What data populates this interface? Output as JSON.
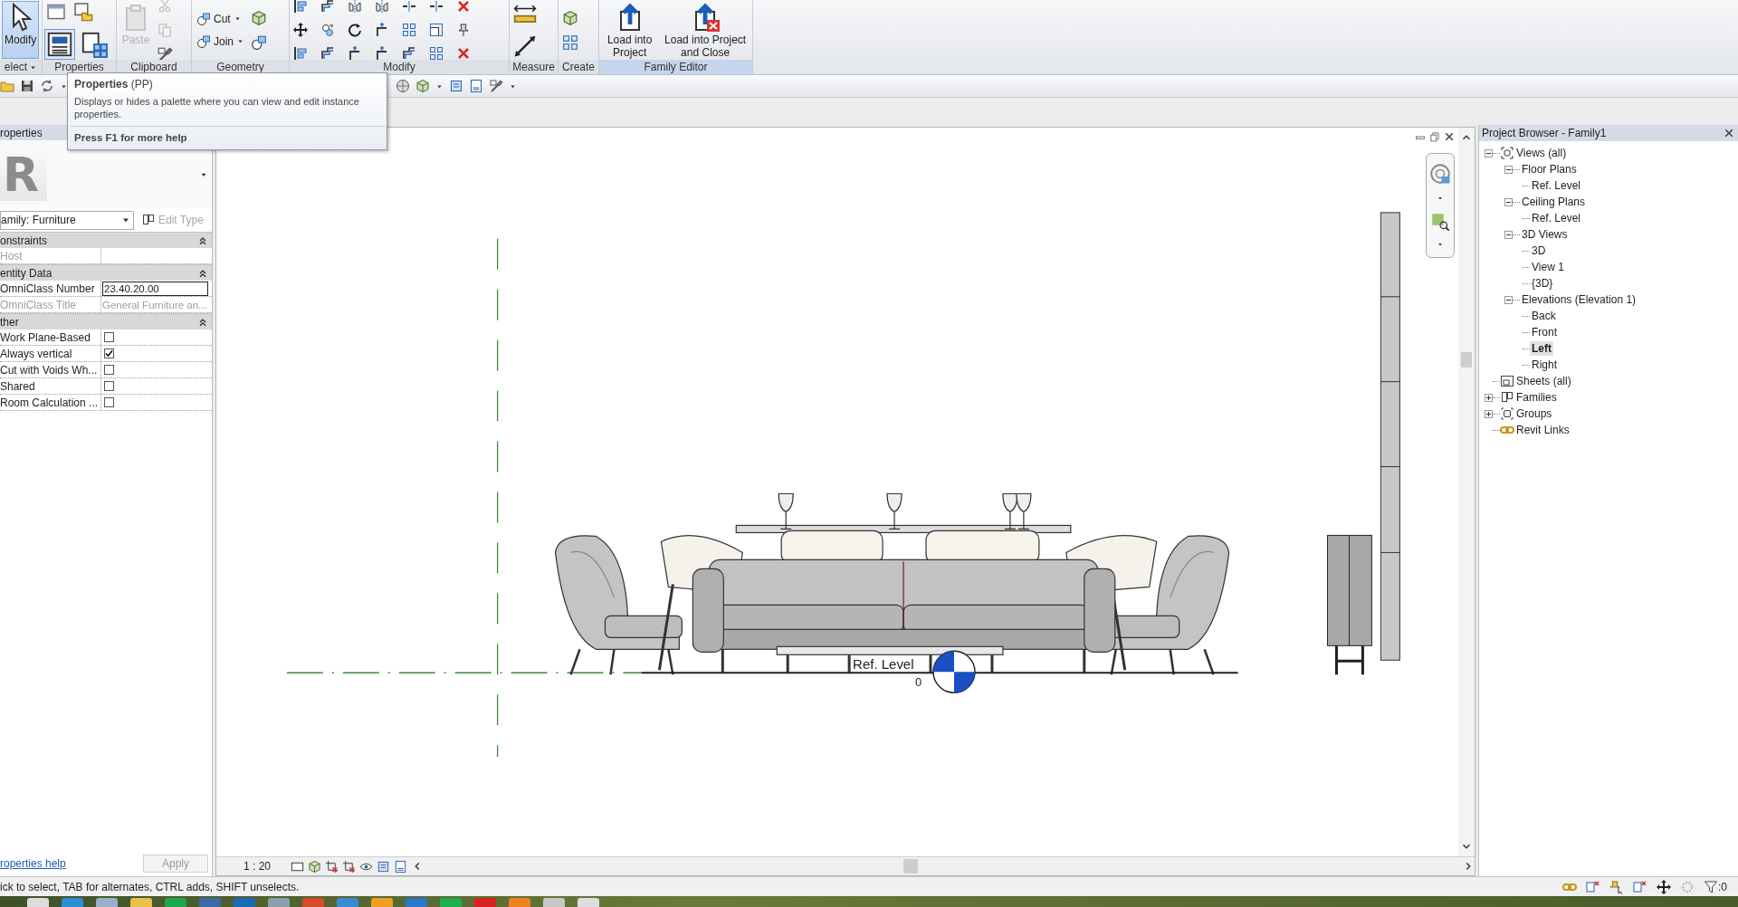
{
  "ribbon": {
    "panels": [
      {
        "label": "elect",
        "menu": true,
        "highlighted": false,
        "tools": [
          {
            "kind": "large",
            "label": "Modify",
            "selected": true,
            "disabled": false
          }
        ]
      },
      {
        "label": "Properties",
        "menu": false,
        "highlighted": false
      },
      {
        "label": "Clipboard",
        "menu": false,
        "highlighted": false,
        "tools": [
          {
            "kind": "large",
            "label": "Paste",
            "selected": false,
            "disabled": true
          }
        ]
      },
      {
        "label": "Geometry",
        "menu": false,
        "highlighted": false,
        "tools": [
          {
            "kind": "small",
            "label": "Cut",
            "selected": false,
            "disabled": false
          },
          {
            "kind": "small",
            "label": "Join",
            "selected": false,
            "disabled": false
          }
        ]
      },
      {
        "label": "Modify",
        "menu": false,
        "highlighted": false
      },
      {
        "label": "Measure",
        "menu": false,
        "highlighted": false
      },
      {
        "label": "Create",
        "menu": false,
        "highlighted": false
      },
      {
        "label": "Family Editor",
        "menu": false,
        "highlighted": true,
        "tools": [
          {
            "kind": "large",
            "label": "Load into Project",
            "selected": false,
            "disabled": false
          },
          {
            "kind": "large",
            "label": "Load into Project and Close",
            "selected": false,
            "disabled": false
          }
        ]
      }
    ]
  },
  "tooltip": {
    "title": "Properties",
    "shortcut": "(PP)",
    "description": "Displays or hides a palette where you can view and edit instance properties.",
    "help": "Press F1 for more help"
  },
  "properties": {
    "title": "roperties",
    "logo": "R",
    "type_selector": "amily: Furniture",
    "edit_type": {
      "label": "Edit Type",
      "disabled": true
    },
    "groups": [
      {
        "label": "onstraints",
        "expanded": true,
        "rows": [
          {
            "kind": "text",
            "name": "Host",
            "disabled": true
          }
        ]
      },
      {
        "label": "entity Data",
        "expanded": true,
        "rows": [
          {
            "kind": "field",
            "name": "OmniClass Number",
            "value": "23.40.20.00",
            "disabled": false
          },
          {
            "kind": "text",
            "name": "OmniClass Title",
            "value": "General Furniture an...",
            "disabled": true
          }
        ]
      },
      {
        "label": "ther",
        "expanded": true,
        "rows": [
          {
            "kind": "check",
            "name": "Work Plane-Based",
            "checked": false,
            "disabled": false
          },
          {
            "kind": "check",
            "name": "Always vertical",
            "checked": true,
            "disabled": false
          },
          {
            "kind": "check",
            "name": "Cut with Voids Wh...",
            "checked": false,
            "disabled": false
          },
          {
            "kind": "check",
            "name": "Shared",
            "checked": false,
            "disabled": false
          },
          {
            "kind": "check",
            "name": "Room Calculation ...",
            "checked": false,
            "disabled": false
          }
        ]
      }
    ],
    "help_link": "roperties help",
    "apply": {
      "label": "Apply",
      "disabled": true
    }
  },
  "view": {
    "level_name": "Ref. Level",
    "level_elevation": "0",
    "scale": "1 : 20"
  },
  "project_browser": {
    "title": "Project Browser - Family1",
    "tree": [
      {
        "label": "Views (all)",
        "selected": false,
        "expanded": true,
        "children": [
          {
            "label": "Floor Plans",
            "selected": false,
            "expanded": true,
            "children": [
              {
                "label": "Ref. Level",
                "selected": false
              }
            ]
          },
          {
            "label": "Ceiling Plans",
            "selected": false,
            "expanded": true,
            "children": [
              {
                "label": "Ref. Level",
                "selected": false
              }
            ]
          },
          {
            "label": "3D Views",
            "selected": false,
            "expanded": true,
            "children": [
              {
                "label": "3D",
                "selected": false
              },
              {
                "label": "View 1",
                "selected": false
              },
              {
                "label": "{3D}",
                "selected": false
              }
            ]
          },
          {
            "label": "Elevations (Elevation 1)",
            "selected": false,
            "expanded": true,
            "children": [
              {
                "label": "Back",
                "selected": false
              },
              {
                "label": "Front",
                "selected": false
              },
              {
                "label": "Left",
                "selected": true
              },
              {
                "label": "Right",
                "selected": false
              }
            ]
          }
        ]
      },
      {
        "label": "Sheets (all)",
        "selected": false
      },
      {
        "label": "Families",
        "selected": false,
        "expanded": false
      },
      {
        "label": "Groups",
        "selected": false,
        "expanded": false
      },
      {
        "label": "Revit Links",
        "selected": false
      }
    ]
  },
  "status_bar": {
    "prompt": "ick to select, TAB for alternates, CTRL adds, SHIFT unselects.",
    "filter_count": ":0"
  }
}
